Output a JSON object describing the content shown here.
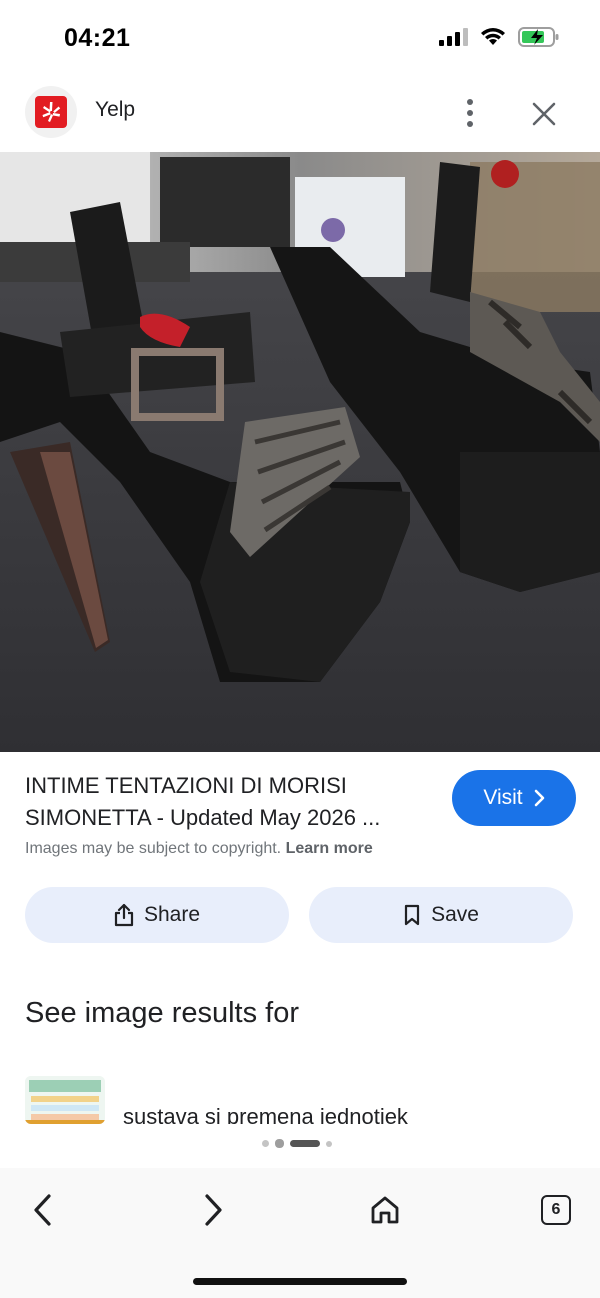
{
  "status_bar": {
    "time": "04:21"
  },
  "header": {
    "site_name": "Yelp"
  },
  "result": {
    "title": "INTIME TENTAZIONI DI MORISI SIMONETTA - Updated May 2026 ...",
    "visit_label": "Visit",
    "copyright_text": "Images may be subject to copyright.",
    "learn_more_label": "Learn more"
  },
  "actions": {
    "share_label": "Share",
    "save_label": "Save"
  },
  "related": {
    "heading": "See image results for",
    "items": [
      {
        "label": "sustava si premena jednotiek"
      }
    ]
  },
  "pager": {
    "active_index": 2,
    "count": 4
  },
  "bottom_nav": {
    "tab_count": "6"
  },
  "colors": {
    "accent": "#1a73e8",
    "yelp_red": "#e21c22",
    "chip_bg": "#e8eefb"
  }
}
